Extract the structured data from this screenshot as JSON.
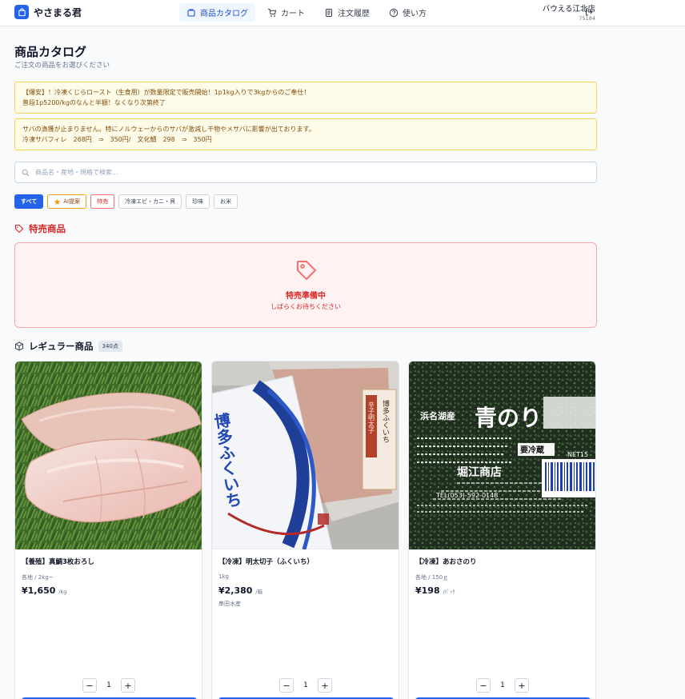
{
  "app": {
    "name": "やさまる君"
  },
  "nav": [
    {
      "label": "商品カタログ",
      "icon": "catalog-icon",
      "active": true
    },
    {
      "label": "カート",
      "icon": "cart-icon",
      "active": false
    },
    {
      "label": "注文履歴",
      "icon": "order-history-icon",
      "active": false
    },
    {
      "label": "使い方",
      "icon": "help-icon",
      "active": false
    }
  ],
  "store": {
    "name": "バウえる江北店",
    "id": "75184"
  },
  "page": {
    "title": "商品カタログ",
    "subtitle": "ご注文の商品をお選びください"
  },
  "notices": [
    {
      "line1": "【爆安】！冷凍くじらロースト（生食用）が数量限定で販売開始！1p1kg入りで3kgからのご奉仕！",
      "line2": "普段1p5200/kgのなんと半額！なくなり次第終了"
    },
    {
      "line1": "サバの漁獲が止まりません。特にノルウェーからのサバが激減し干物やメサバに影響が出ております。",
      "line2": "冷凍サバフィレ　268円　⇒　350円/　文化鯖　298　⇒　350円"
    }
  ],
  "search": {
    "placeholder": "商品名・産地・規格で検索..."
  },
  "filters": [
    "すべて",
    "AI提案",
    "特売",
    "冷凍エビ・カニ・貝",
    "珍味",
    "お米"
  ],
  "sale_section": {
    "title": "特売商品",
    "empty_title": "特売準備中",
    "empty_message": "しばらくお待ちください"
  },
  "regular_section": {
    "title": "レギュラー商品",
    "count": "340点"
  },
  "products": [
    {
      "name": "【養殖】真鯛3枚おろし",
      "spec": "各地 / 2kg~",
      "price": "¥1,650",
      "unit": "/kg",
      "maker": "",
      "qty": "1"
    },
    {
      "name": "【冷凍】明太切子（ふくいち）",
      "spec": "1kg",
      "price": "¥2,380",
      "unit": "/箱",
      "maker": "串田水産",
      "qty": "1"
    },
    {
      "name": "【冷凍】あおさのり",
      "spec": "各地 / 150ｇ",
      "price": "¥198",
      "unit": "/ﾊﾟｯｸ",
      "maker": "",
      "qty": "1"
    }
  ],
  "package_texts": {
    "mentai_brand": "博多ふくいち",
    "mentai_label": "辛子明太子",
    "nori_origin": "浜名湖産",
    "nori_name": "青のり",
    "nori_cold": "要冷蔵",
    "nori_net": "NET15",
    "nori_shop": "堀江商店",
    "nori_tel": "TEL(053)-592-0148"
  },
  "colors": {
    "accent": "#2563eb",
    "sale": "#dc2626",
    "notice_bg": "#fefce8",
    "notice_border": "#fcd34d"
  }
}
